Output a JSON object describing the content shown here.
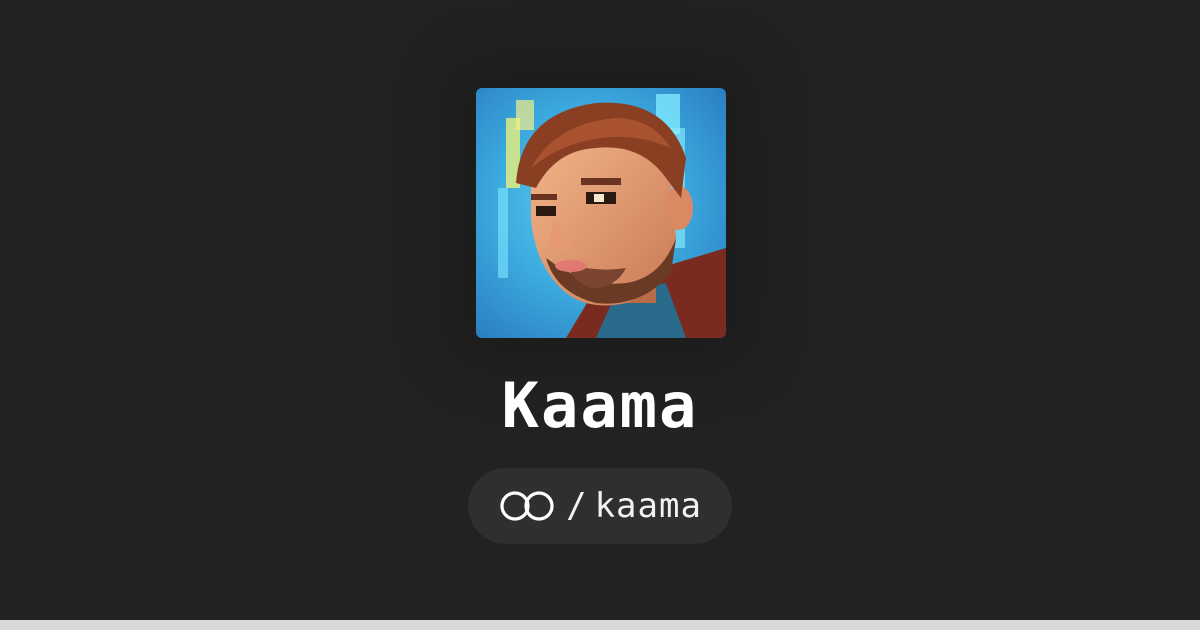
{
  "profile": {
    "display_name": "Kaama",
    "handle_separator": "/",
    "handle": "kaama",
    "avatar_icon": "avatar-portrait",
    "platform_icon": "linked-rings-icon"
  },
  "colors": {
    "background": "#222222",
    "pill_background": "#2f2f2f",
    "text": "#ffffff",
    "bottom_bar": "#d9d9d9"
  }
}
